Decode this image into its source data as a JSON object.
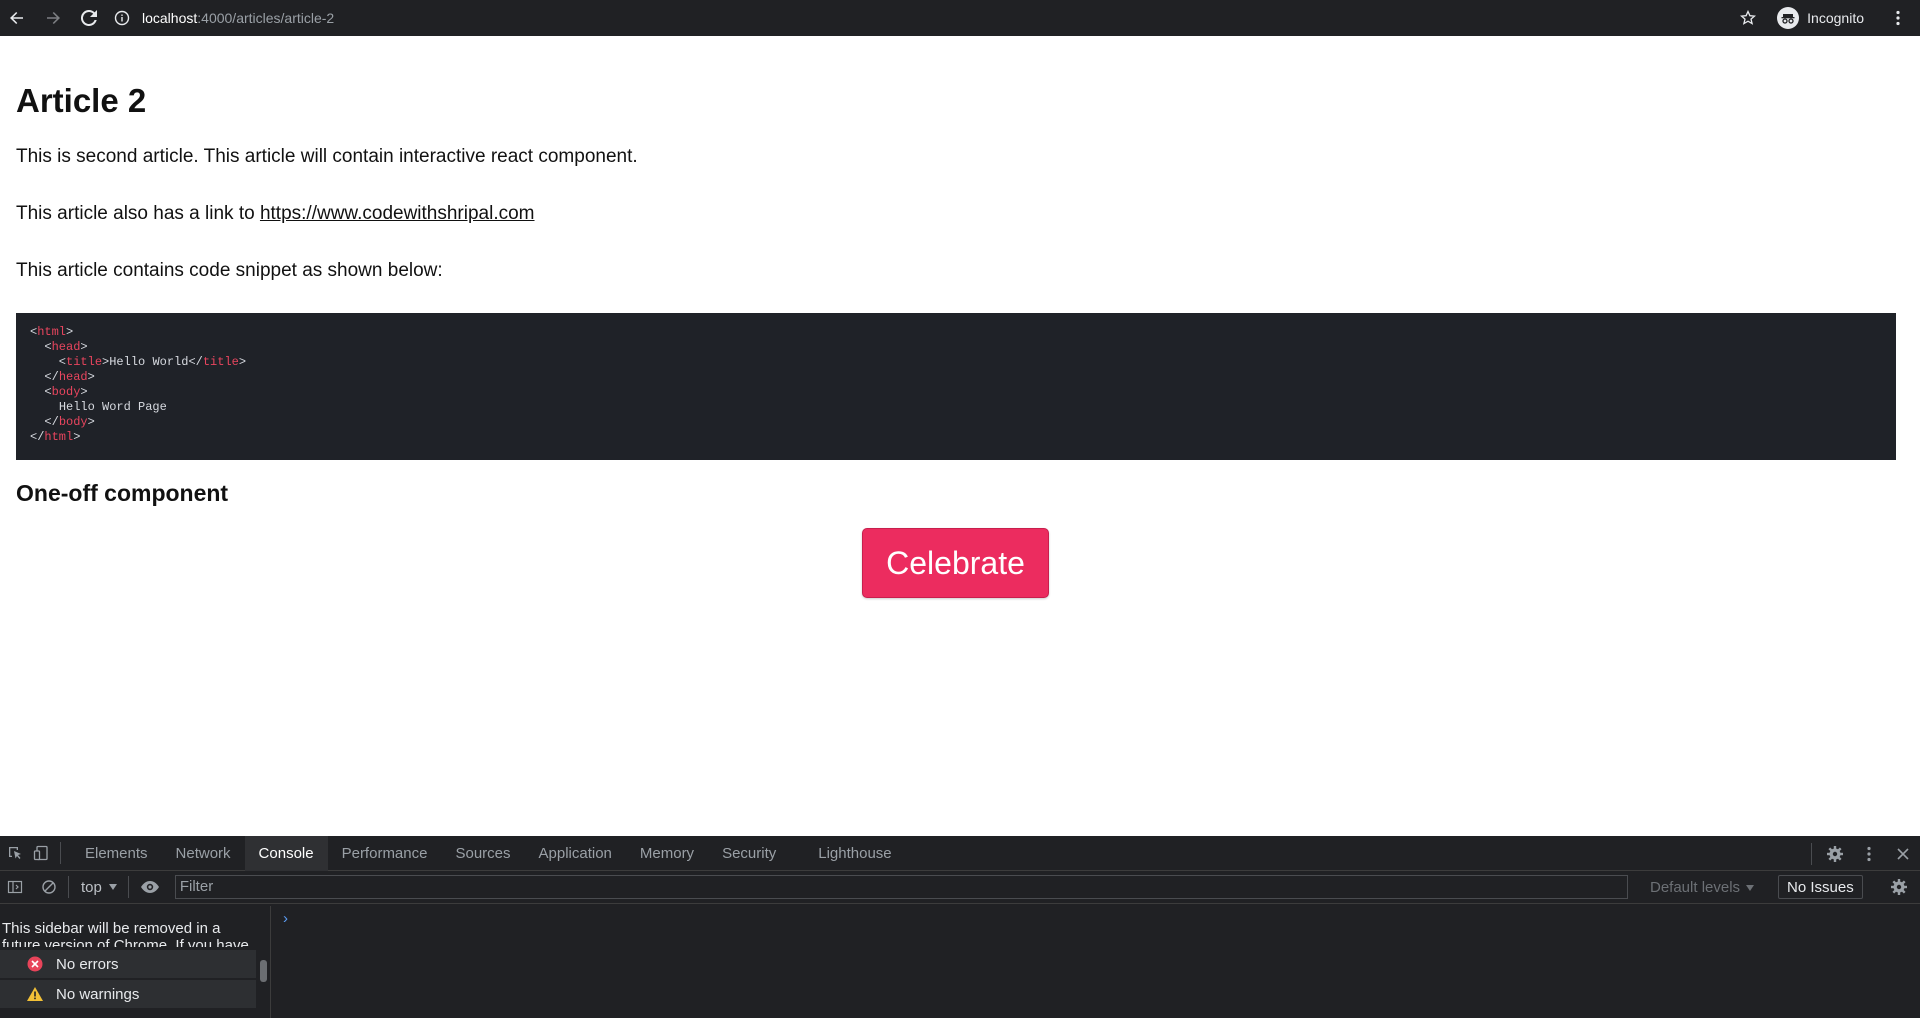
{
  "browser": {
    "url_host": "localhost",
    "url_path": ":4000/articles/article-2",
    "profile_label": "Incognito"
  },
  "article": {
    "title": "Article 2",
    "para1": "This is second article. This article will contain interactive react component.",
    "para2_prefix": "This article also has a link to ",
    "link_text": "https://www.codewithshripal.com",
    "para3": "This article contains code snippet as shown below:",
    "code_lines": [
      {
        "indent": "",
        "open": "<",
        "tag": "html",
        "close": ">",
        "text": ""
      },
      {
        "indent": "  ",
        "open": "<",
        "tag": "head",
        "close": ">",
        "text": ""
      },
      {
        "indent": "    ",
        "open": "<",
        "tag": "title",
        "close": ">",
        "text": "Hello World</title>"
      },
      {
        "indent": "  ",
        "open": "</",
        "tag": "head",
        "close": ">",
        "text": ""
      },
      {
        "indent": "  ",
        "open": "<",
        "tag": "body",
        "close": ">",
        "text": ""
      },
      {
        "indent": "    ",
        "open": "",
        "tag": "",
        "close": "",
        "text": "Hello Word Page"
      },
      {
        "indent": "  ",
        "open": "</",
        "tag": "body",
        "close": ">",
        "text": ""
      },
      {
        "indent": "",
        "open": "</",
        "tag": "html",
        "close": ">",
        "text": ""
      }
    ],
    "subheading": "One-off component",
    "button_label": "Celebrate"
  },
  "devtools": {
    "tabs": [
      "Elements",
      "Network",
      "Console",
      "Performance",
      "Sources",
      "Application",
      "Memory",
      "Security",
      "Lighthouse"
    ],
    "active_tab": "Console",
    "context": "top",
    "filter_placeholder": "Filter",
    "levels": "Default levels",
    "issues": "No Issues",
    "sidebar_message": "This sidebar will be removed in a future version of Chrome. If you have",
    "sidebar_items": [
      {
        "label": "No errors",
        "icon": "error-icon"
      },
      {
        "label": "No warnings",
        "icon": "warning-icon"
      }
    ],
    "prompt": "›"
  },
  "colors": {
    "button": "#ec2c5f",
    "code_bg": "#1f2228",
    "code_tag": "#e8455e",
    "devtools_bg": "#202124"
  }
}
